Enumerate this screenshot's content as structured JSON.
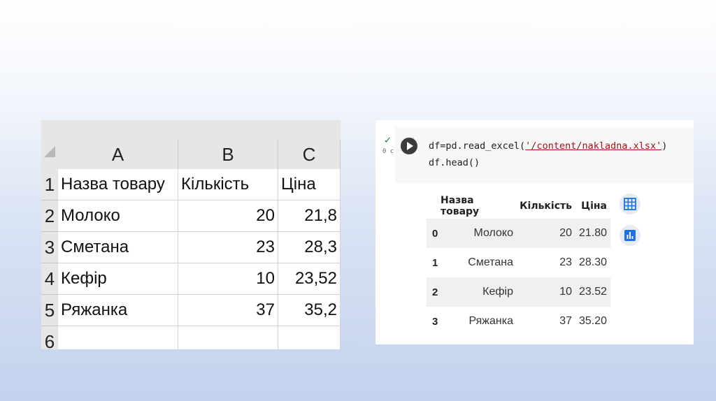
{
  "excel": {
    "columns": [
      "A",
      "B",
      "C"
    ],
    "row_numbers": [
      "1",
      "2",
      "3",
      "4",
      "5",
      "6"
    ],
    "rows": [
      [
        "Назва товару",
        "Кількість",
        "Ціна"
      ],
      [
        "Молоко",
        "20",
        "21,8"
      ],
      [
        "Сметана",
        "23",
        "28,3"
      ],
      [
        "Кефір",
        "10",
        "23,52"
      ],
      [
        "Ряжанка",
        "37",
        "35,2"
      ],
      [
        "",
        "",
        ""
      ]
    ]
  },
  "colab": {
    "exec_status": "0 с",
    "code": {
      "line1_prefix": "df=pd.read_excel(",
      "line1_quote_open": "'",
      "line1_string": "/content/nakladna.xlsx",
      "line1_quote_close": "'",
      "line1_suffix": ")",
      "line2": "df.head()"
    },
    "dataframe": {
      "headers": [
        "Назва товару",
        "Кількість",
        "Ціна"
      ],
      "rows": [
        {
          "index": "0",
          "name": "Молоко",
          "qty": "20",
          "price": "21.80"
        },
        {
          "index": "1",
          "name": "Сметана",
          "qty": "23",
          "price": "28.30"
        },
        {
          "index": "2",
          "name": "Кефір",
          "qty": "10",
          "price": "23.52"
        },
        {
          "index": "3",
          "name": "Ряжанка",
          "qty": "37",
          "price": "35.20"
        }
      ]
    },
    "side_buttons": [
      "table-icon",
      "chart-icon"
    ],
    "accent_color": "#1a73e8"
  }
}
